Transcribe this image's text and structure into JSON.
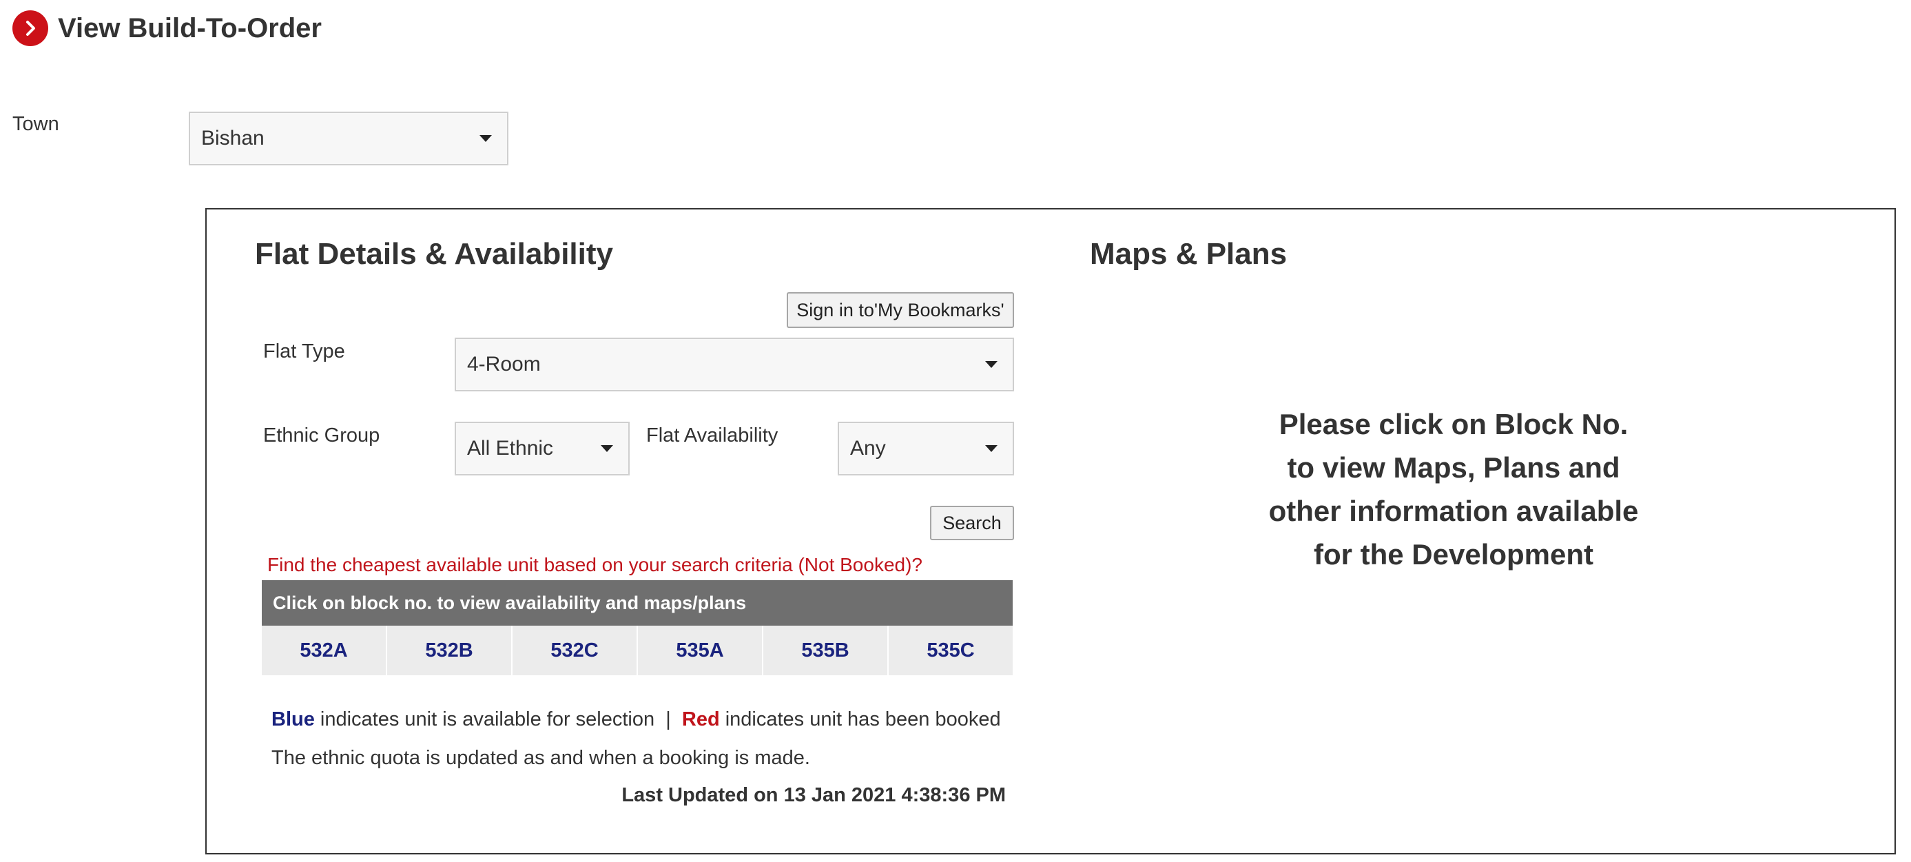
{
  "page": {
    "title": "View Build-To-Order",
    "header_icon": "chevron-right-icon",
    "accent_color": "#cc1118"
  },
  "town": {
    "label": "Town",
    "selected": "Bishan"
  },
  "flat_details": {
    "heading": "Flat Details & Availability",
    "bookmark_button": "Sign in to'My Bookmarks'",
    "flat_type_label": "Flat Type",
    "flat_type_selected": "4-Room",
    "ethnic_group_label": "Ethnic Group",
    "ethnic_group_selected": "All Ethnic",
    "flat_availability_label": "Flat Availability",
    "flat_availability_selected": "Any",
    "search_button": "Search",
    "cheapest_link": "Find the cheapest available unit based on your search criteria (Not Booked)?",
    "blocks_header": "Click on block no. to view availability and maps/plans",
    "blocks": [
      "532A",
      "532B",
      "532C",
      "535A",
      "535B",
      "535C"
    ],
    "legend": {
      "blue_word": "Blue",
      "blue_text": " indicates unit is available for selection  |  ",
      "red_word": "Red",
      "red_text": " indicates unit has been booked"
    },
    "quota_note": "The ethnic quota is updated as and when a booking is made.",
    "last_updated": "Last Updated on 13 Jan 2021 4:38:36 PM",
    "colors": {
      "available": "#1a237e",
      "booked": "#c0141b"
    }
  },
  "maps_plans": {
    "heading": "Maps & Plans",
    "message_lines": [
      "Please click on Block No.",
      "to view Maps, Plans and",
      "other information available",
      "for the Development"
    ]
  }
}
